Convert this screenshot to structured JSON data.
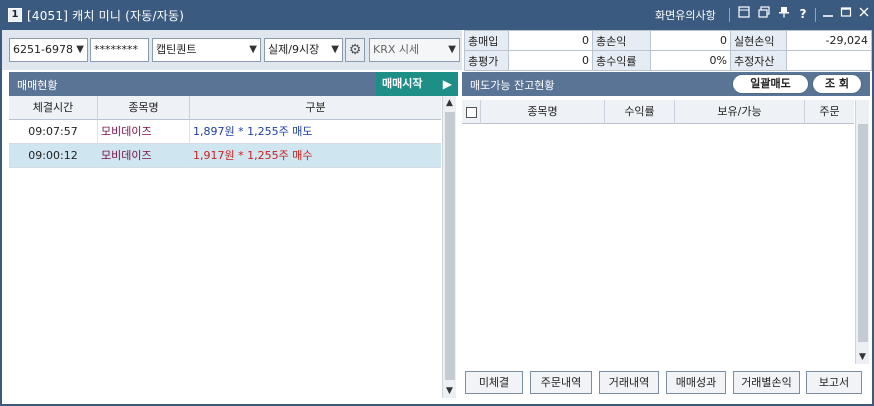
{
  "window": {
    "badge": "1",
    "title": "[4051] 캐치 미니 (자동/자동)",
    "notice_label": "화면유의사항",
    "icons": [
      "restore-icon",
      "cascade-icon",
      "pin-icon",
      "help-icon",
      "minimize-icon",
      "maximize-icon",
      "close-icon"
    ]
  },
  "toolbar": {
    "account": "6251-6978",
    "password": "********",
    "strategy": "캡틴퀀트",
    "mode": "실제/9시장",
    "market": "KRX 시세"
  },
  "summary": {
    "rows": [
      [
        {
          "label": "총매입",
          "value": "0"
        },
        {
          "label": "총손익",
          "value": "0"
        },
        {
          "label": "실현손익",
          "value": "-29,024"
        }
      ],
      [
        {
          "label": "총평가",
          "value": "0"
        },
        {
          "label": "총수익률",
          "value": "0%"
        },
        {
          "label": "추정자산",
          "value": ""
        }
      ]
    ]
  },
  "trade_panel": {
    "title": "매매현황",
    "start_button": "매매시작",
    "columns": [
      "체결시간",
      "종목명",
      "구분"
    ],
    "rows": [
      {
        "time": "09:07:57",
        "name": "모비데이즈",
        "detail": "1,897원 * 1,255주 매도",
        "side": "sell"
      },
      {
        "time": "09:00:12",
        "name": "모비데이즈",
        "detail": "1,917원 * 1,255주 매수",
        "side": "buy"
      }
    ]
  },
  "holdings_panel": {
    "title": "매도가능 잔고현황",
    "bulk_sell_button": "일괄매도",
    "query_button": "조 회",
    "columns": [
      "종목명",
      "수익률",
      "보유/가능",
      "주문"
    ]
  },
  "bottom_buttons": [
    "미체결",
    "주문내역",
    "거래내역",
    "매매성과",
    "거래별손익",
    "보고서"
  ],
  "colors": {
    "titlebar": "#3b5a80",
    "section_header": "#5a7495",
    "start_button": "#1e8f86",
    "sell_text": "#1f3fa0",
    "buy_text": "#d01c1c",
    "stock_name": "#7a1048",
    "selected_row": "#cfe6f1"
  }
}
